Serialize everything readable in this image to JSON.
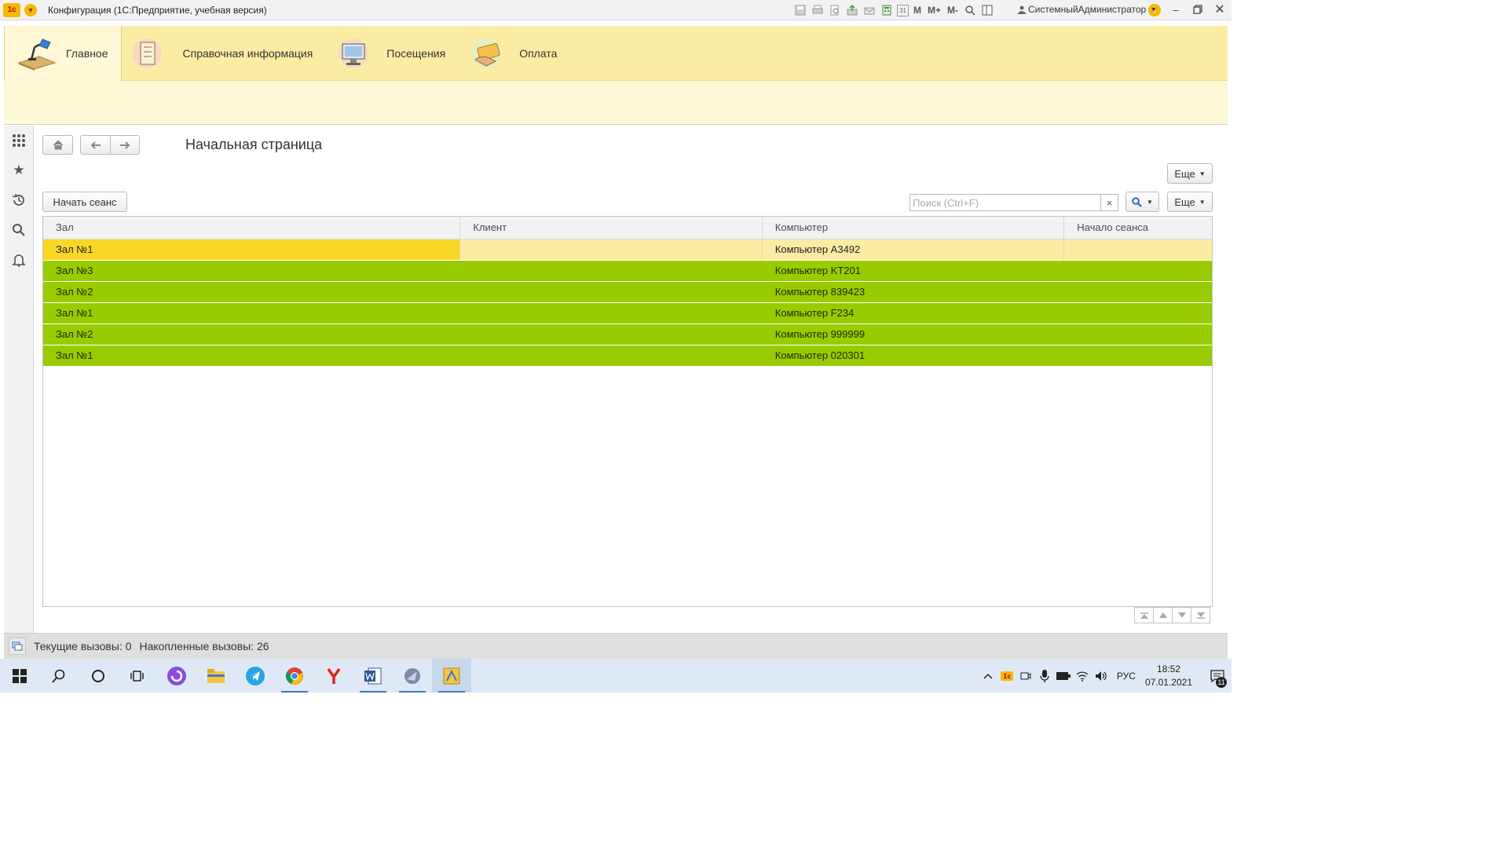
{
  "titlebar": {
    "app_title": "Конфигурация (1С:Предприятие, учебная версия)",
    "logo": "1с",
    "tool_icons": [
      "save-icon",
      "print-icon",
      "preview-icon",
      "attach-icon",
      "mail-icon",
      "calculator-icon",
      "calendar-icon"
    ],
    "calendar_day": "31",
    "memory": [
      "M",
      "M+",
      "M-"
    ],
    "user": "СистемныйАдминистратор"
  },
  "sections": [
    {
      "label": "Главное",
      "icon": "desk-lamp-icon",
      "active": true
    },
    {
      "label": "Справочная информация",
      "icon": "notebook-icon",
      "active": false
    },
    {
      "label": "Посещения",
      "icon": "monitor-icon",
      "active": false
    },
    {
      "label": "Оплата",
      "icon": "payment-card-icon",
      "active": false
    }
  ],
  "leftpanel": [
    "all-functions-icon",
    "favorites-icon",
    "history-icon",
    "search-icon",
    "notifications-icon"
  ],
  "form": {
    "title": "Начальная страница",
    "more_label": "Еще",
    "start_session_label": "Начать сеанс",
    "search_placeholder": "Поиск (Ctrl+F)",
    "search_clear": "×"
  },
  "table": {
    "columns": [
      "Зал",
      "Клиент",
      "Компьютер",
      "Начало сеанса"
    ],
    "rows": [
      {
        "hall": "Зал №1",
        "client": "",
        "computer": "Компьютер A3492",
        "start": "",
        "status": "current"
      },
      {
        "hall": "Зал №3",
        "client": "",
        "computer": "Компьютер KT201",
        "start": "",
        "status": "free"
      },
      {
        "hall": "Зал №2",
        "client": "",
        "computer": "Компьютер 839423",
        "start": "",
        "status": "free"
      },
      {
        "hall": "Зал №1",
        "client": "",
        "computer": "Компьютер F234",
        "start": "",
        "status": "free"
      },
      {
        "hall": "Зал №2",
        "client": "",
        "computer": "Компьютер 999999",
        "start": "",
        "status": "free"
      },
      {
        "hall": "Зал №1",
        "client": "",
        "computer": "Компьютер 020301",
        "start": "",
        "status": "free"
      }
    ]
  },
  "statusbar": {
    "current_calls": "Текущие вызовы: 0",
    "accumulated_calls": "Накопленные вызовы: 26"
  },
  "taskbar": {
    "apps": [
      "windows-start-icon",
      "search-icon",
      "cortana-icon",
      "task-view-icon",
      "alice-icon",
      "explorer-icon",
      "telegram-icon",
      "chrome-icon",
      "yandex-browser-icon",
      "word-icon",
      "app-icon",
      "1c-enterprise-icon"
    ],
    "language": "РУС",
    "time": "18:52",
    "date": "07.01.2021",
    "notifications": "11"
  },
  "colors": {
    "sections_bg": "#fbeca3",
    "row_free": "#99cc00",
    "row_current": "#fbeca3",
    "cell_selected": "#f9d726"
  }
}
